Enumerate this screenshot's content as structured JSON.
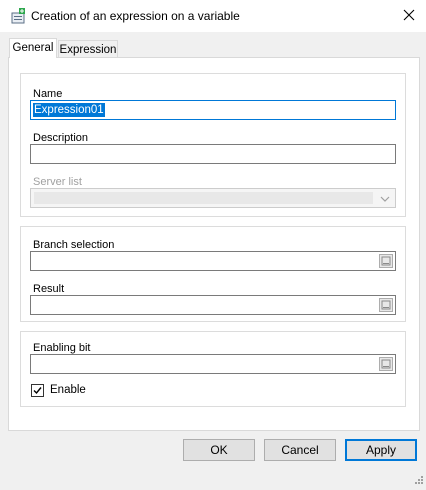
{
  "window": {
    "title": "Creation of an expression on a variable",
    "app_icon": "variable-expression-icon",
    "close_icon": "close-icon"
  },
  "tabs": [
    {
      "label": "General",
      "active": true
    },
    {
      "label": "Expression",
      "active": false
    }
  ],
  "general": {
    "name_label": "Name",
    "name_value": "Expression01",
    "description_label": "Description",
    "description_value": "",
    "server_list_label": "Server list",
    "server_list_value": "",
    "server_list_disabled": true,
    "branch_selection_label": "Branch selection",
    "branch_selection_value": "",
    "result_label": "Result",
    "result_value": "",
    "enabling_bit_label": "Enabling bit",
    "enabling_bit_value": "",
    "enable_label": "Enable",
    "enable_checked": true
  },
  "buttons": {
    "ok": "OK",
    "cancel": "Cancel",
    "apply": "Apply"
  },
  "colors": {
    "accent": "#0078d7",
    "window_bg": "#f0f0f0",
    "panel_bg": "#ffffff"
  }
}
